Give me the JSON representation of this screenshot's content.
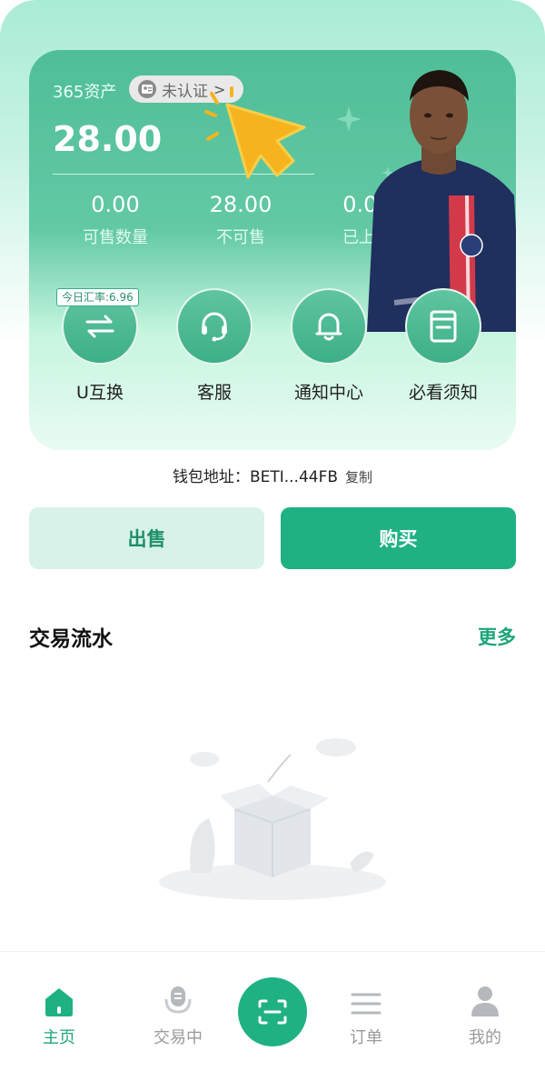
{
  "asset": {
    "label": "365资产",
    "verify_status": "未认证",
    "balance": "28.00",
    "stats": [
      {
        "value": "0.00",
        "label": "可售数量"
      },
      {
        "value": "28.00",
        "label": "不可售"
      },
      {
        "value": "0.00",
        "label": "已上架"
      }
    ]
  },
  "quick_actions": {
    "rate_tag": "今日汇率:6.96",
    "items": [
      {
        "label": "U互换",
        "icon": "swap-icon"
      },
      {
        "label": "客服",
        "icon": "headset-icon"
      },
      {
        "label": "通知中心",
        "icon": "bell-icon"
      },
      {
        "label": "必看须知",
        "icon": "document-icon"
      }
    ]
  },
  "wallet": {
    "label": "钱包地址：",
    "address": "BETI...44FB",
    "copy": "复制"
  },
  "actions": {
    "sell": "出售",
    "buy": "购买"
  },
  "transactions": {
    "title": "交易流水",
    "more": "更多"
  },
  "tabbar": {
    "home": "主页",
    "trading": "交易中",
    "orders": "订单",
    "mine": "我的"
  },
  "colors": {
    "accent": "#1fb183",
    "card": "#4fbe98",
    "sell_bg": "#d8f2e9"
  }
}
